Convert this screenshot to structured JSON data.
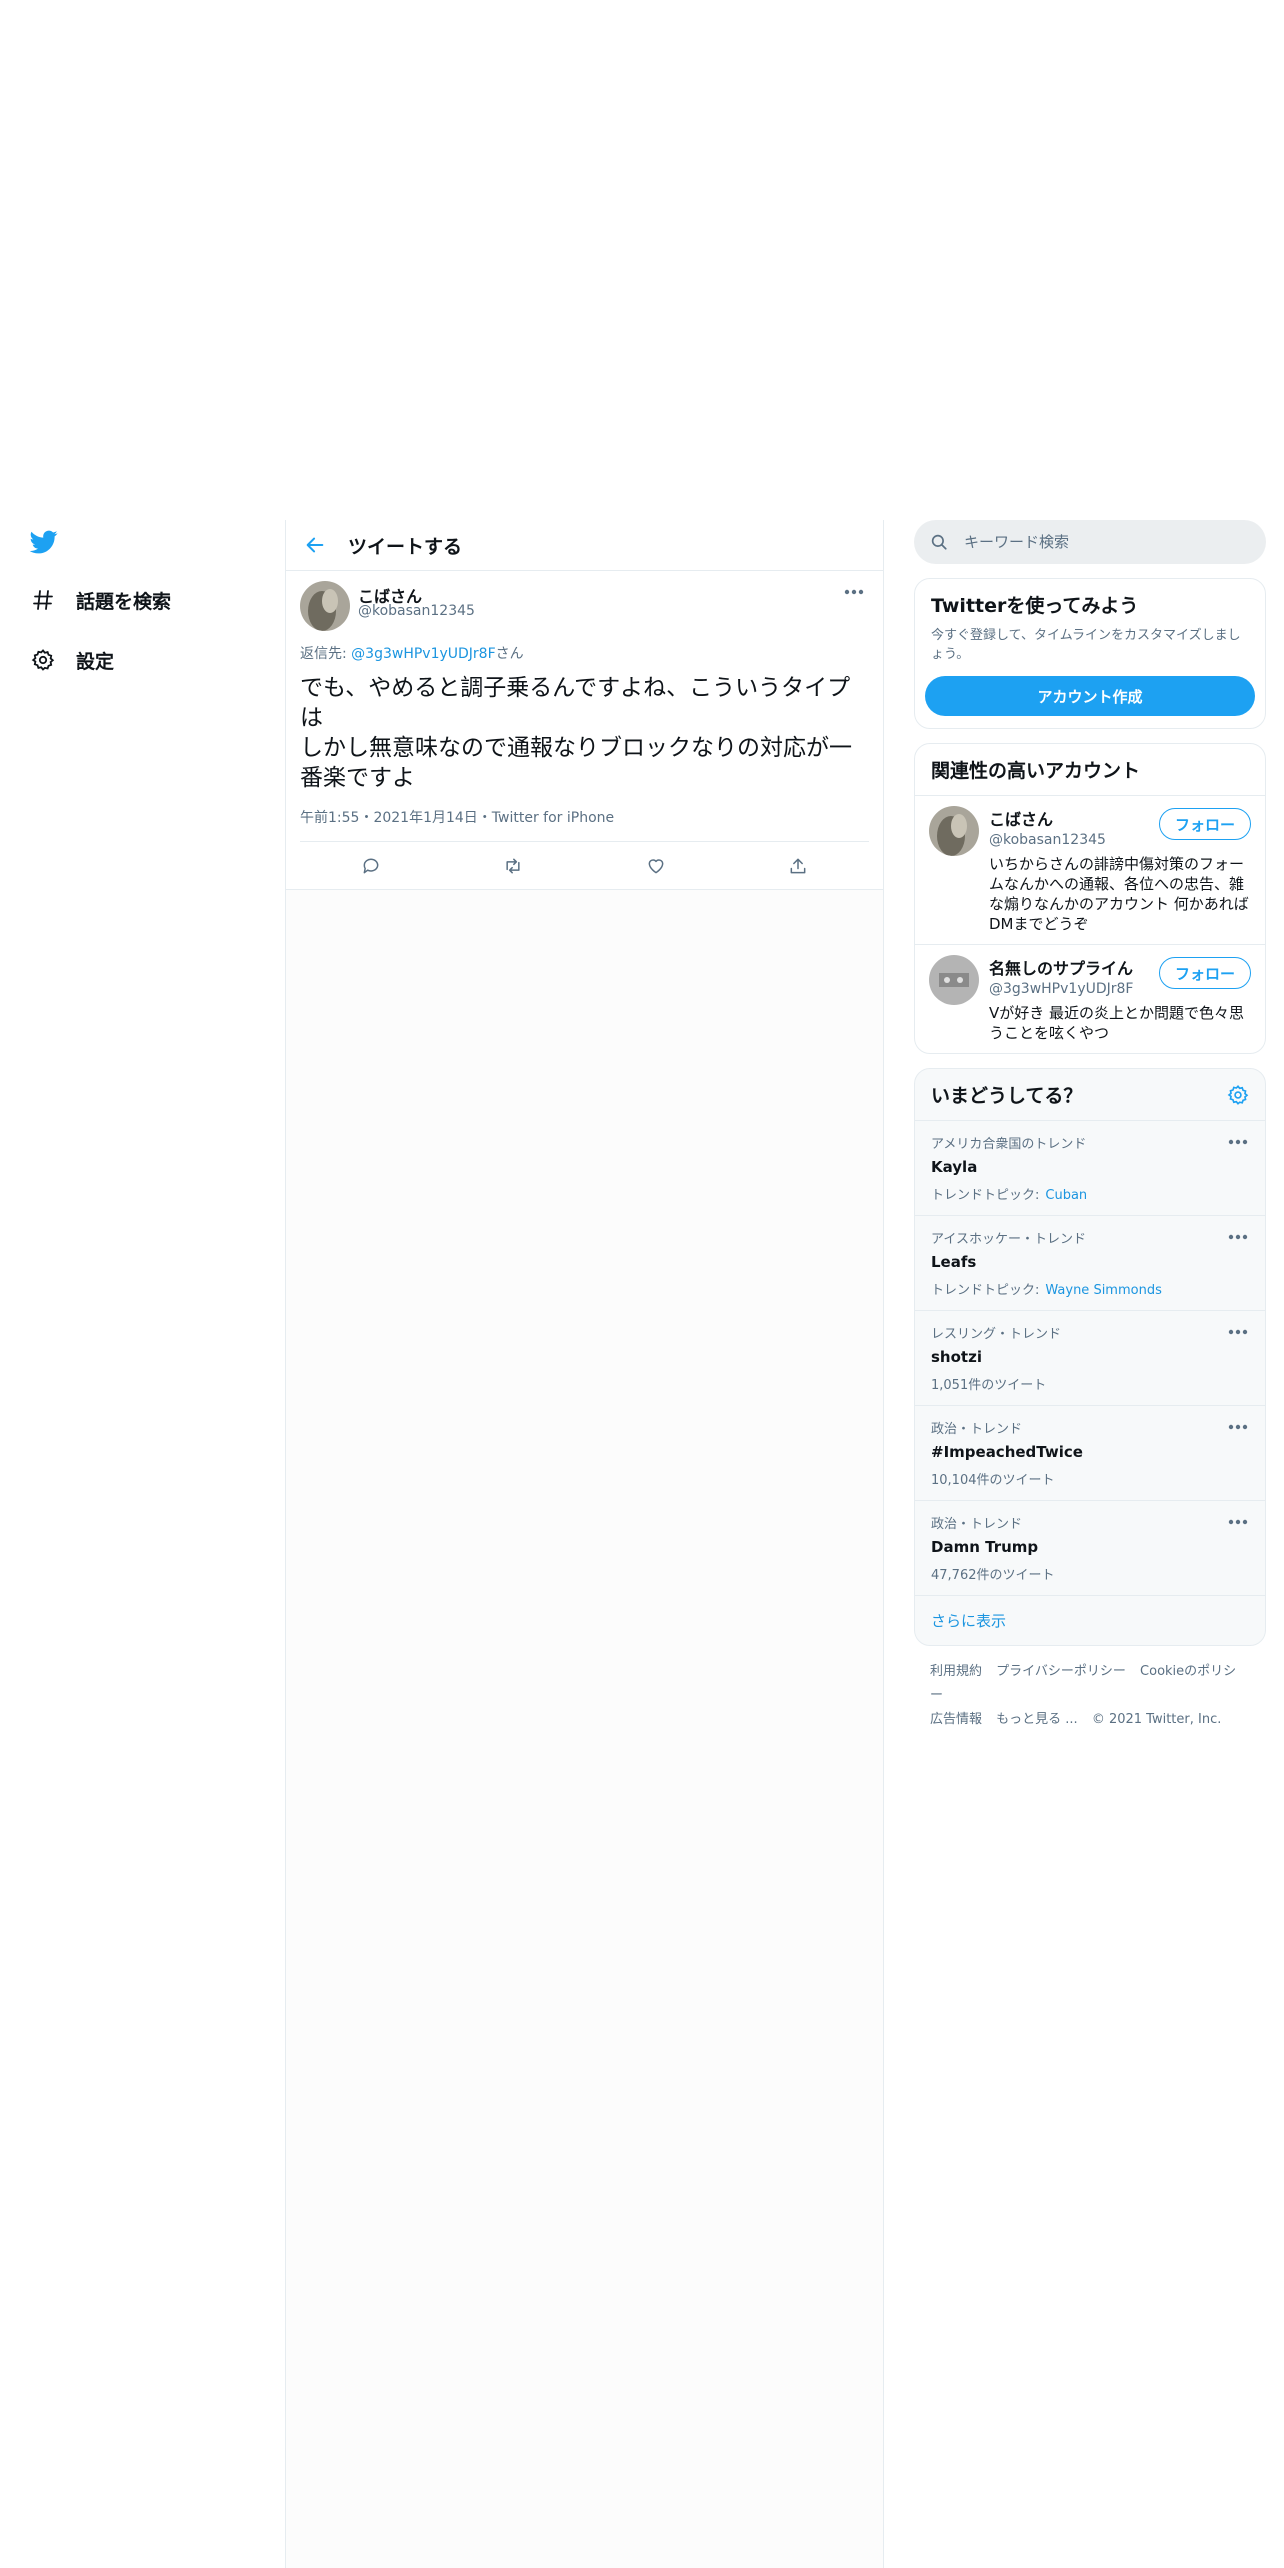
{
  "nav": {
    "logo": "twitter-bird-icon",
    "items": [
      {
        "label": "話題を検索",
        "icon": "hashtag-icon"
      },
      {
        "label": "設定",
        "icon": "gear-icon"
      }
    ]
  },
  "main": {
    "title": "ツイートする",
    "tweet": {
      "author_name": "こばさん",
      "author_handle": "@kobasan12345",
      "reply_prefix": "返信先: ",
      "reply_to": "@3g3wHPv1yUDJr8F",
      "reply_suffix": "さん",
      "text_line1": "でも、やめると調子乗るんですよね、こういうタイプは",
      "text_line2": "しかし無意味なので通報なりブロックなりの対応が一番楽ですよ",
      "meta": "午前1:55・2021年1月14日・Twitter for iPhone",
      "actions": [
        "reply-icon",
        "retweet-icon",
        "like-icon",
        "share-icon"
      ]
    }
  },
  "side": {
    "search_placeholder": "キーワード検索",
    "signup": {
      "title": "Twitterを使ってみよう",
      "desc": "今すぐ登録して、タイムラインをカスタマイズしましょう。",
      "button": "アカウント作成"
    },
    "related": {
      "title": "関連性の高いアカウント",
      "accounts": [
        {
          "name": "こばさん",
          "handle": "@kobasan12345",
          "bio": "いちからさんの誹謗中傷対策のフォームなんかへの通報、各位への忠告、雑な煽りなんかのアカウント 何かあればDMまでどうぞ",
          "follow": "フォロー"
        },
        {
          "name": "名無しのサプライん",
          "handle": "@3g3wHPv1yUDJr8F",
          "bio": "Vが好き 最近の炎上とか問題で色々思うことを呟くやつ",
          "follow": "フォロー"
        }
      ]
    },
    "trends": {
      "title": "いまどうしてる？",
      "items": [
        {
          "context": "アメリカ合衆国のトレンド",
          "name": "Kayla",
          "sub": "トレンドトピック:",
          "topic": "Cuban"
        },
        {
          "context": "アイスホッケー・トレンド",
          "name": "Leafs",
          "sub": "トレンドトピック:",
          "topic": "Wayne Simmonds"
        },
        {
          "context": "レスリング・トレンド",
          "name": "shotzi",
          "sub": "1,051件のツイート",
          "topic": ""
        },
        {
          "context": "政治・トレンド",
          "name": "#ImpeachedTwice",
          "sub": "10,104件のツイート",
          "topic": ""
        },
        {
          "context": "政治・トレンド",
          "name": "Damn Trump",
          "sub": "47,762件のツイート",
          "topic": ""
        }
      ],
      "show_more": "さらに表示"
    },
    "footer": {
      "links": [
        "利用規約",
        "プライバシーポリシー",
        "Cookieのポリシー",
        "広告情報",
        "もっと見る ..."
      ],
      "copyright": "© 2021 Twitter, Inc."
    },
    "colors": {
      "accent": "#1da1f2",
      "link": "#1b95e0",
      "muted": "#5b7083"
    }
  }
}
